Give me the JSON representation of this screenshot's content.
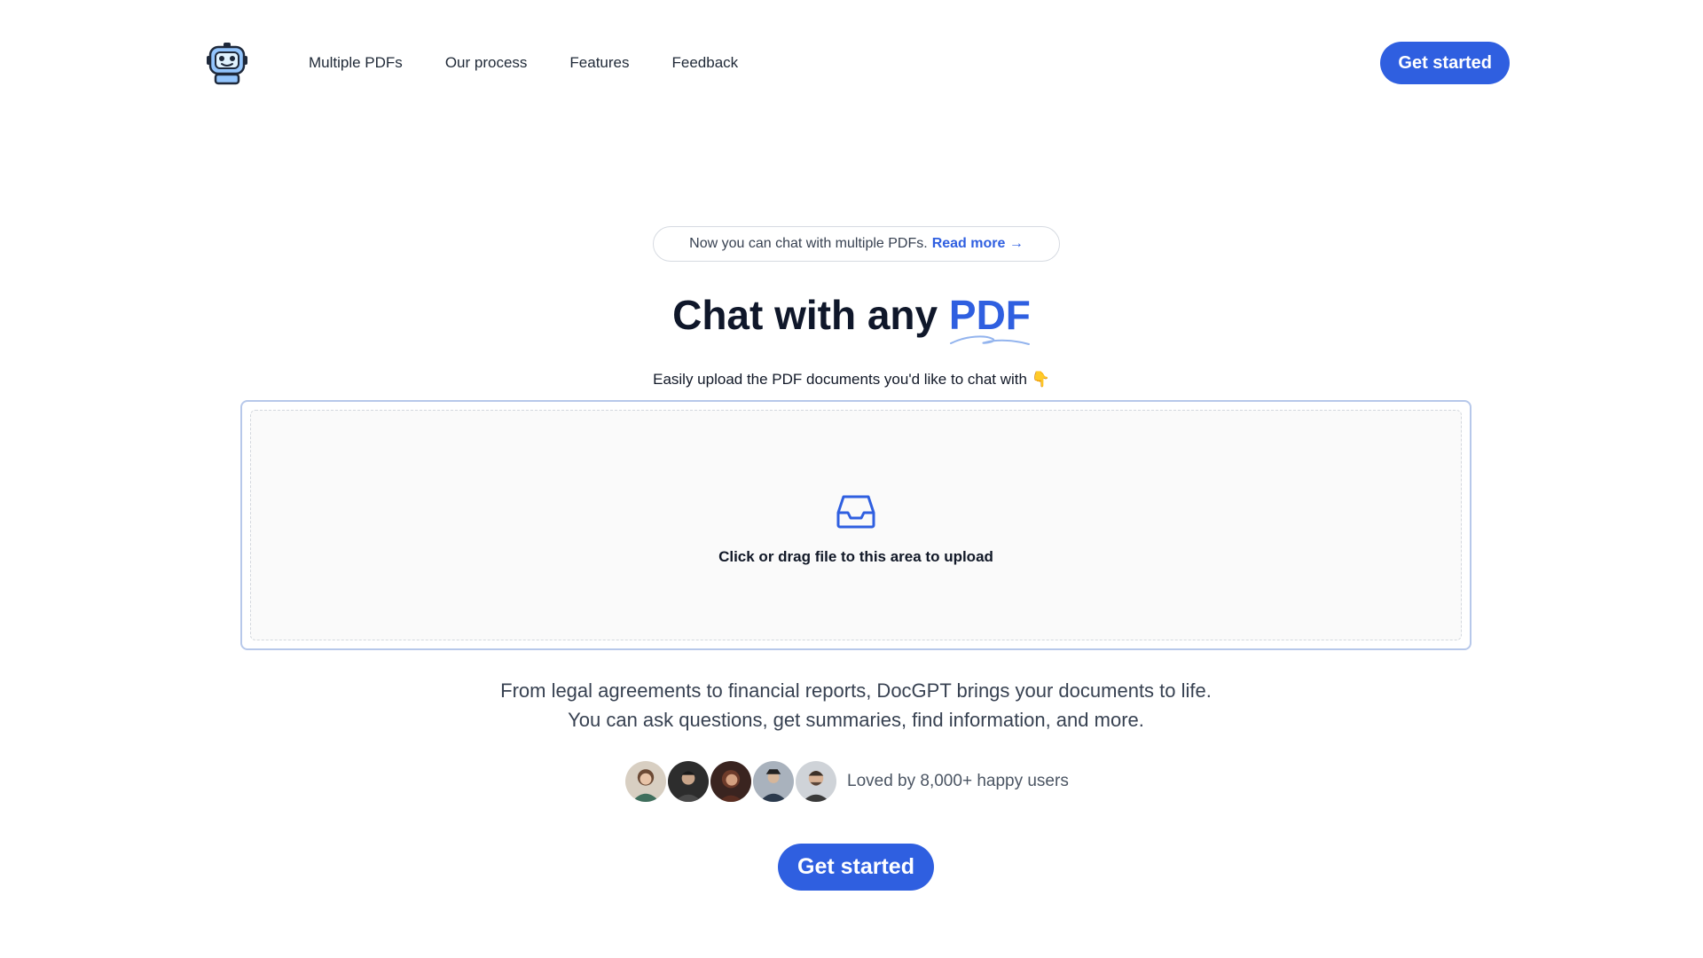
{
  "header": {
    "logo_icon": "robot-icon",
    "nav": [
      {
        "label": "Multiple PDFs"
      },
      {
        "label": "Our process"
      },
      {
        "label": "Features"
      },
      {
        "label": "Feedback"
      }
    ],
    "cta_label": "Get started"
  },
  "announcement": {
    "text": "Now you can chat with multiple PDFs.",
    "link_label": "Read more →"
  },
  "hero": {
    "title_prefix": "Chat with any",
    "title_accent": "PDF",
    "subtitle": "Easily upload the PDF documents you'd like to chat with",
    "subtitle_emoji": "👇"
  },
  "upload": {
    "icon": "inbox-icon",
    "text": "Click or drag file to this area to upload"
  },
  "description": "From legal agreements to financial reports, DocGPT brings your documents to life. You can ask questions, get summaries, find information, and more.",
  "social_proof": {
    "avatar_count": 5,
    "text": "Loved by 8,000+ happy users"
  },
  "cta": {
    "label": "Get started"
  },
  "colors": {
    "primary": "#2f5fe0",
    "heading": "#0f172a",
    "upload_border": "#b7c8ea"
  }
}
